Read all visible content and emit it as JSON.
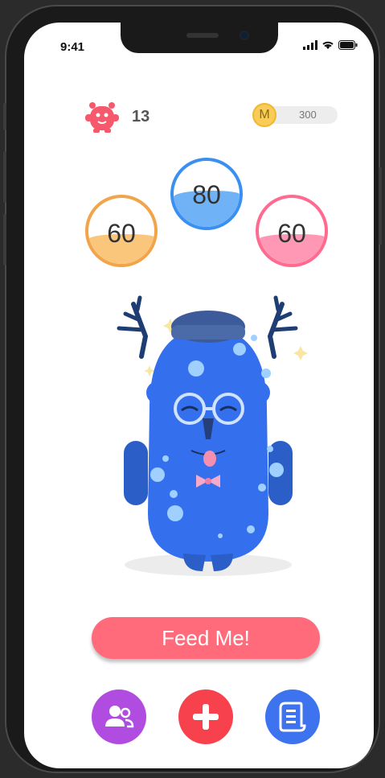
{
  "status_bar": {
    "time": "9:41"
  },
  "header": {
    "level": "13",
    "coins": "300",
    "coin_letter": "M"
  },
  "stats": [
    {
      "value": "60",
      "fill": 0.45,
      "color": "#f2a44a",
      "fill_color": "#f9c67c"
    },
    {
      "value": "80",
      "fill": 0.55,
      "color": "#3a8ff0",
      "fill_color": "#6fb3f6"
    },
    {
      "value": "60",
      "fill": 0.45,
      "color": "#ff6a8f",
      "fill_color": "#ff98b4"
    }
  ],
  "feed_button": {
    "label": "Feed Me!"
  },
  "nav": {
    "colors": [
      "#b04de0",
      "#f7424e",
      "#3e73f0"
    ],
    "icons": [
      "friends-icon",
      "add-icon",
      "list-icon"
    ]
  }
}
